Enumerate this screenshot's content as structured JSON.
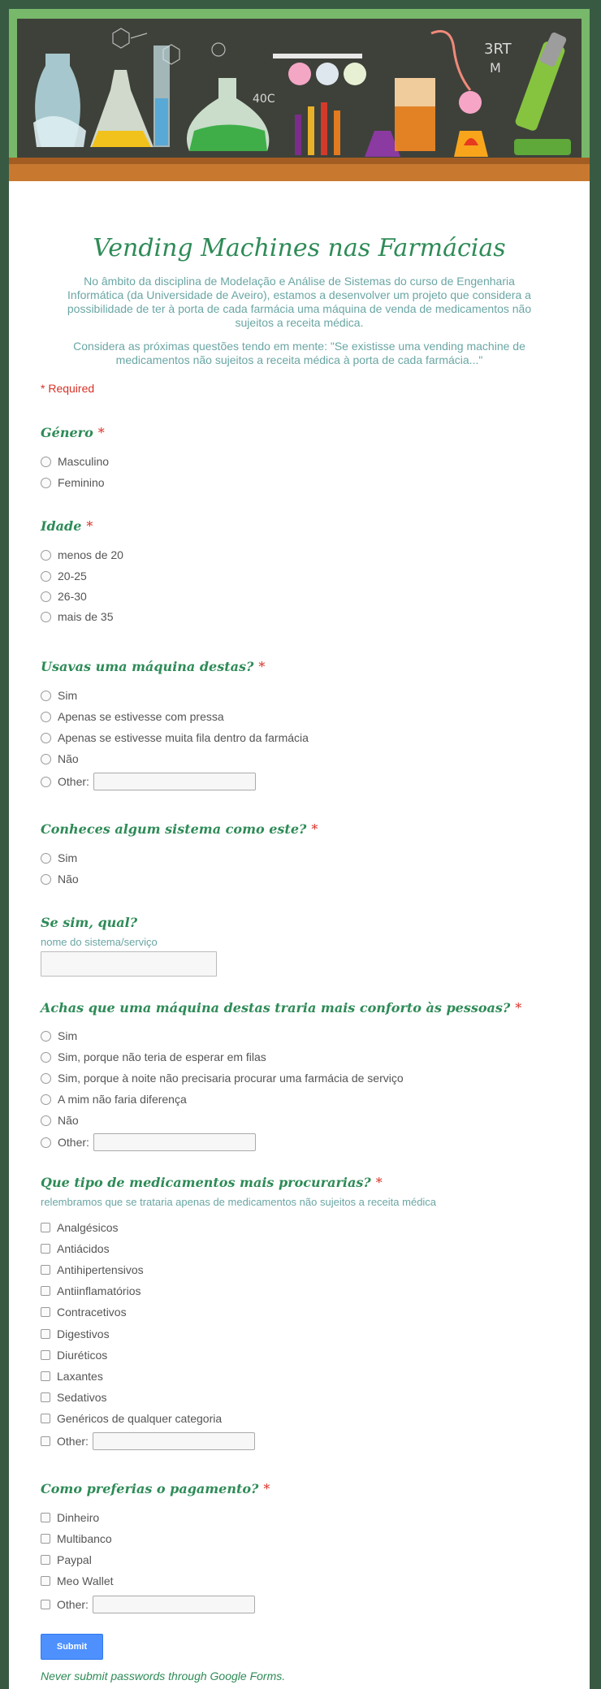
{
  "banner": {
    "chalk_text": [
      "40C",
      "3RT",
      "M"
    ]
  },
  "form": {
    "title": "Vending Machines nas Farmácias",
    "description": "No âmbito da disciplina de Modelação e Análise de Sistemas do curso de Engenharia Informática (da Universidade de Aveiro), estamos a desenvolver um projeto que considera a possibilidade de ter à porta de cada farmácia uma máquina de venda de medicamentos não sujeitos a receita médica.",
    "description2": "Considera as próximas questões tendo em mente: \"Se existisse uma vending machine de medicamentos não sujeitos a receita médica à porta de cada farmácia...\"",
    "required_note": "* Required",
    "required_mark": "*",
    "other_label": "Other:"
  },
  "questions": {
    "genero": {
      "title": "Género",
      "options": [
        "Masculino",
        "Feminino"
      ]
    },
    "idade": {
      "title": "Idade",
      "options": [
        "menos de 20",
        "20-25",
        "26-30",
        "mais de 35"
      ]
    },
    "usavas": {
      "title": "Usavas uma máquina destas?",
      "options": [
        "Sim",
        "Apenas se estivesse com pressa",
        "Apenas se estivesse muita fila dentro da farmácia",
        "Não"
      ]
    },
    "conheces": {
      "title": "Conheces algum sistema como este?",
      "options": [
        "Sim",
        "Não"
      ]
    },
    "qual": {
      "title": "Se sim, qual?",
      "help": "nome do sistema/serviço"
    },
    "conforto": {
      "title": "Achas que uma máquina destas traria mais conforto às pessoas?",
      "options": [
        "Sim",
        "Sim, porque não teria de esperar em filas",
        "Sim, porque à noite não precisaria procurar uma farmácia de serviço",
        "A mim não faria diferença",
        "Não"
      ]
    },
    "medicamentos": {
      "title": "Que tipo de medicamentos mais procurarias?",
      "help": "relembramos que se trataria apenas de medicamentos não sujeitos a receita médica",
      "options": [
        "Analgésicos",
        "Antiácidos",
        "Antihipertensivos",
        "Antiinflamatórios",
        "Contracetivos",
        "Digestivos",
        "Diuréticos",
        "Laxantes",
        "Sedativos",
        "Genéricos de qualquer categoria"
      ]
    },
    "pagamento": {
      "title": "Como preferias o pagamento?",
      "options": [
        "Dinheiro",
        "Multibanco",
        "Paypal",
        "Meo Wallet"
      ]
    }
  },
  "submit": {
    "label": "Submit"
  },
  "footer": {
    "warning": "Never submit passwords through Google Forms."
  },
  "colors": {
    "background": "#385a42",
    "title": "#2e8b57",
    "description": "#6aa6a4",
    "required": "#d93025",
    "submit": "#4d90fe"
  }
}
